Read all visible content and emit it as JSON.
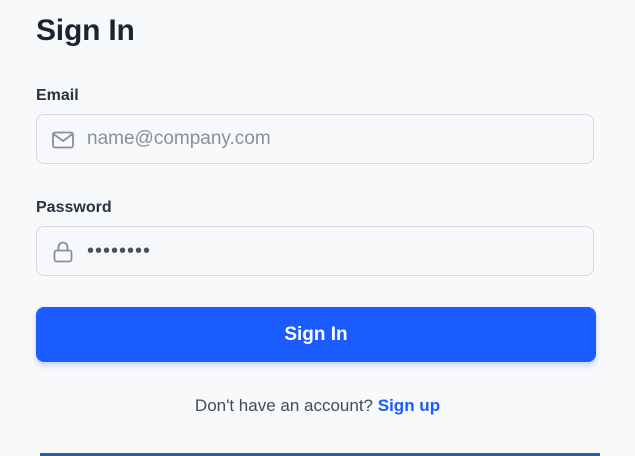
{
  "form": {
    "title": "Sign In",
    "email": {
      "label": "Email",
      "placeholder": "name@company.com",
      "value": "",
      "icon": "mail-icon"
    },
    "password": {
      "label": "Password",
      "value": "••••••••",
      "icon": "lock-icon"
    },
    "submit_label": "Sign In",
    "signup_prompt": "Don't have an account?",
    "signup_link": "Sign up"
  },
  "colors": {
    "primary": "#1a5cff",
    "background": "#f8f9fb",
    "border": "#d3d7de",
    "text": "#1c2430"
  }
}
